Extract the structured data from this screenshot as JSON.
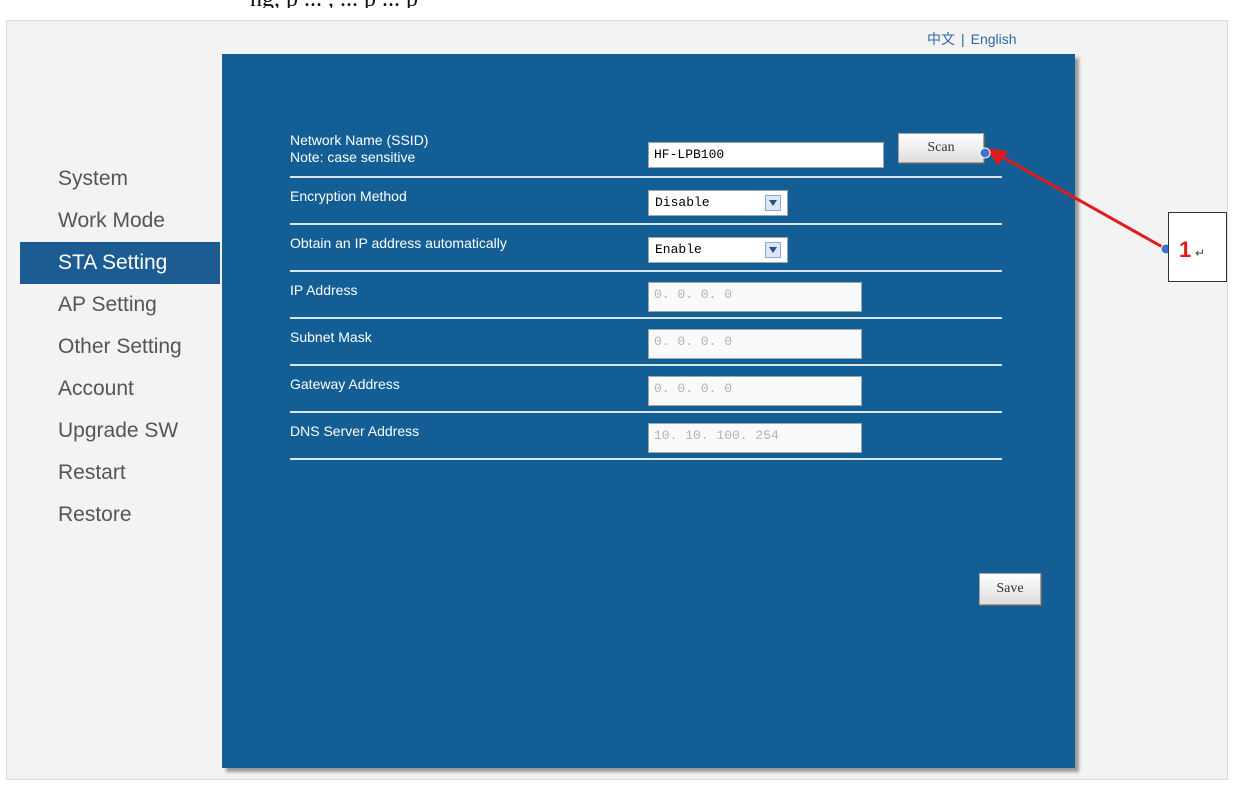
{
  "document_fragment": "ng, p ... , ... p ... p",
  "language": {
    "chinese": "中文",
    "separator": "|",
    "english": "English"
  },
  "sidebar": {
    "items": [
      {
        "label": "System",
        "active": false
      },
      {
        "label": "Work Mode",
        "active": false
      },
      {
        "label": "STA Setting",
        "active": true
      },
      {
        "label": "AP Setting",
        "active": false
      },
      {
        "label": "Other Setting",
        "active": false
      },
      {
        "label": "Account",
        "active": false
      },
      {
        "label": "Upgrade SW",
        "active": false
      },
      {
        "label": "Restart",
        "active": false
      },
      {
        "label": "Restore",
        "active": false
      }
    ]
  },
  "form": {
    "ssid": {
      "label": "Network Name (SSID)",
      "note": "Note: case sensitive",
      "value": "HF-LPB100"
    },
    "scan_label": "Scan",
    "encryption": {
      "label": "Encryption Method",
      "value": "Disable"
    },
    "dhcp": {
      "label": "Obtain an IP address automatically",
      "value": "Enable"
    },
    "ip": {
      "label": "IP Address",
      "value": "0. 0. 0. 0"
    },
    "subnet": {
      "label": "Subnet Mask",
      "value": "0. 0. 0. 0"
    },
    "gateway": {
      "label": "Gateway Address",
      "value": "0. 0. 0. 0"
    },
    "dns": {
      "label": "DNS Server Address",
      "value": "10. 10. 100. 254"
    },
    "save_label": "Save"
  },
  "annotation": {
    "number": "1",
    "mark": "↵"
  },
  "colors": {
    "panel": "#135f95",
    "active_nav": "#1d5c93",
    "arrow": "#e11b1b",
    "link": "#2c67a6"
  }
}
